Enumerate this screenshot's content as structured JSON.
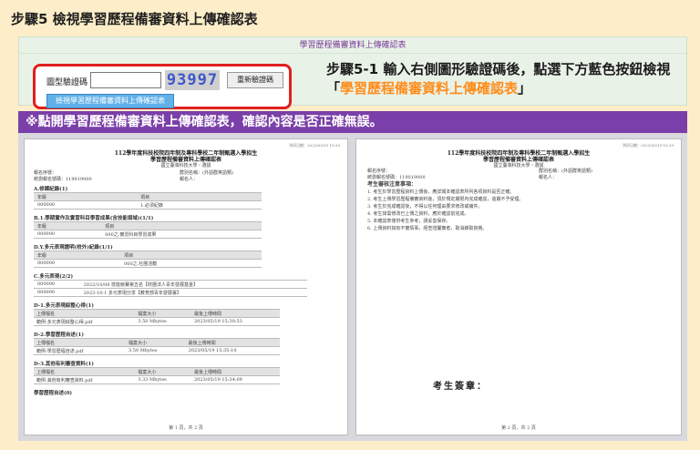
{
  "step_title": "步驟5 檢視學習歷程備審資料上傳確認表",
  "panel_header": "學習歷程備審資料上傳確認表",
  "captcha": {
    "label": "圖型驗證碼",
    "code": "93997",
    "refresh_label": "重新驗證碼",
    "view_button_label": "檢視學習歷程備審資料上傳確認表"
  },
  "instruction": {
    "text": "步驟5-1 輸入右側圖形驗證碼後，點選下方藍色按鈕檢視「",
    "highlight": "學習歷程備審資料上傳確認表",
    "suffix": "」"
  },
  "purple_bar": "※點開學習歷程備審資料上傳確認表，確認內容是否正確無誤。",
  "page_left": {
    "stamp": "列印日期：2023/05/19 15:39",
    "title1": "112學年度科技校院四年制及專科學校二年制甄選入學招生",
    "title2": "學習歷程備審資料上傳確認表",
    "title3": "國立臺灣科技大學・選拔",
    "meta_left1": "報名序號：",
    "meta_left2": "統測報名號碼：119019000",
    "meta_right1": "群別名稱：(外語群英語類)",
    "meta_right2": "報名人：",
    "sections": [
      {
        "head": "A.修課紀錄(1)",
        "header_row": [
          "年級",
          "項目"
        ],
        "rows": [
          [
            "000000",
            "1.必須紀錄"
          ]
        ]
      },
      {
        "head": "B.1.學期實作及實習科目學習成果(含技能領域)(1/1)",
        "header_row": [
          "年級",
          "項目"
        ],
        "rows": [
          [
            "000000",
            "000之.實習科目學習成果"
          ]
        ]
      },
      {
        "head": "D.Y.多元表現證明(校外)紀錄(1/1)",
        "header_row": [
          "年級",
          "項目"
        ],
        "rows": [
          [
            "000000",
            "000之.社團活動"
          ]
        ]
      },
      {
        "head": "C.多元表現(2/2)",
        "header_row": [],
        "rows": [
          [
            "000000",
            "2022/10/08 技能競賽第五名【財團法人青年發展基金】"
          ],
          [
            "000000",
            "2023-10-1 多元表現分享【教育部青年發展署】"
          ]
        ]
      }
    ],
    "file_sections": [
      {
        "head": "D-1.多元表現綜整心得(1)",
        "header": [
          "上傳檔名",
          "檔案大小",
          "最後上傳時間"
        ],
        "row": [
          "範例-多元表現綜整心得.pdf",
          "3.50 Mbytes",
          "2023/05/19 15:30:53"
        ]
      },
      {
        "head": "D-2.學習歷程自述(1)",
        "header": [
          "上傳檔名",
          "檔案大小",
          "最後上傳時間"
        ],
        "row": [
          "範例-學習歷程自述.pdf",
          "3.50 Mbytes",
          "2023/05/19 15:35:10"
        ]
      },
      {
        "head": "D-3.其他有利審查資料(1)",
        "header": [
          "上傳檔名",
          "檔案大小",
          "最後上傳時間"
        ],
        "row": [
          "範例-其他有利審查資料.pdf",
          "3.33 Mbytes",
          "2023/05/19 15:34:09"
        ]
      }
    ],
    "last_head": "學習歷程自述(0)",
    "footer": "第 1 頁，共 2 頁"
  },
  "page_right": {
    "stamp": "列印日期：2023/05/19 15:39",
    "title1": "112學年度科技校院四年制及專科學校二年制甄選入學招生",
    "title2": "學習歷程備審資料上傳確認表",
    "title3": "國立臺灣科技大學・選拔",
    "meta_left1": "報名序號：",
    "meta_left2": "統測報名號碼：119019000",
    "meta_right1": "群別名稱：(外語群英語類)",
    "meta_right2": "報名人：",
    "notes_head": "考生審核注意事項：",
    "notes": [
      "1. 考生於學習歷程資料上傳後，應詳閱本確認表所列各項資料是否正確。",
      "2. 考生上傳學習歷程備審資料後，須於規定期限內完成確認，逾期不予受理。",
      "3. 考生於完成確認後，不得以任何理由要求修改或補件。",
      "4. 考生如需修改已上傳之資料，應於確認前完成。",
      "5. 本確認表僅供考生參考，請妥善保存。",
      "6. 上傳資料如有不實情事，經查證屬實者，取消錄取資格。"
    ],
    "signature": "考生簽章：",
    "footer": "第 2 頁，共 2 頁"
  },
  "colors": {
    "background": "#fdeec9",
    "purple_bar": "#7a3fa8",
    "highlight": "#ff8c1a",
    "captcha_border": "#e02020",
    "button_blue": "#62b0e8"
  }
}
